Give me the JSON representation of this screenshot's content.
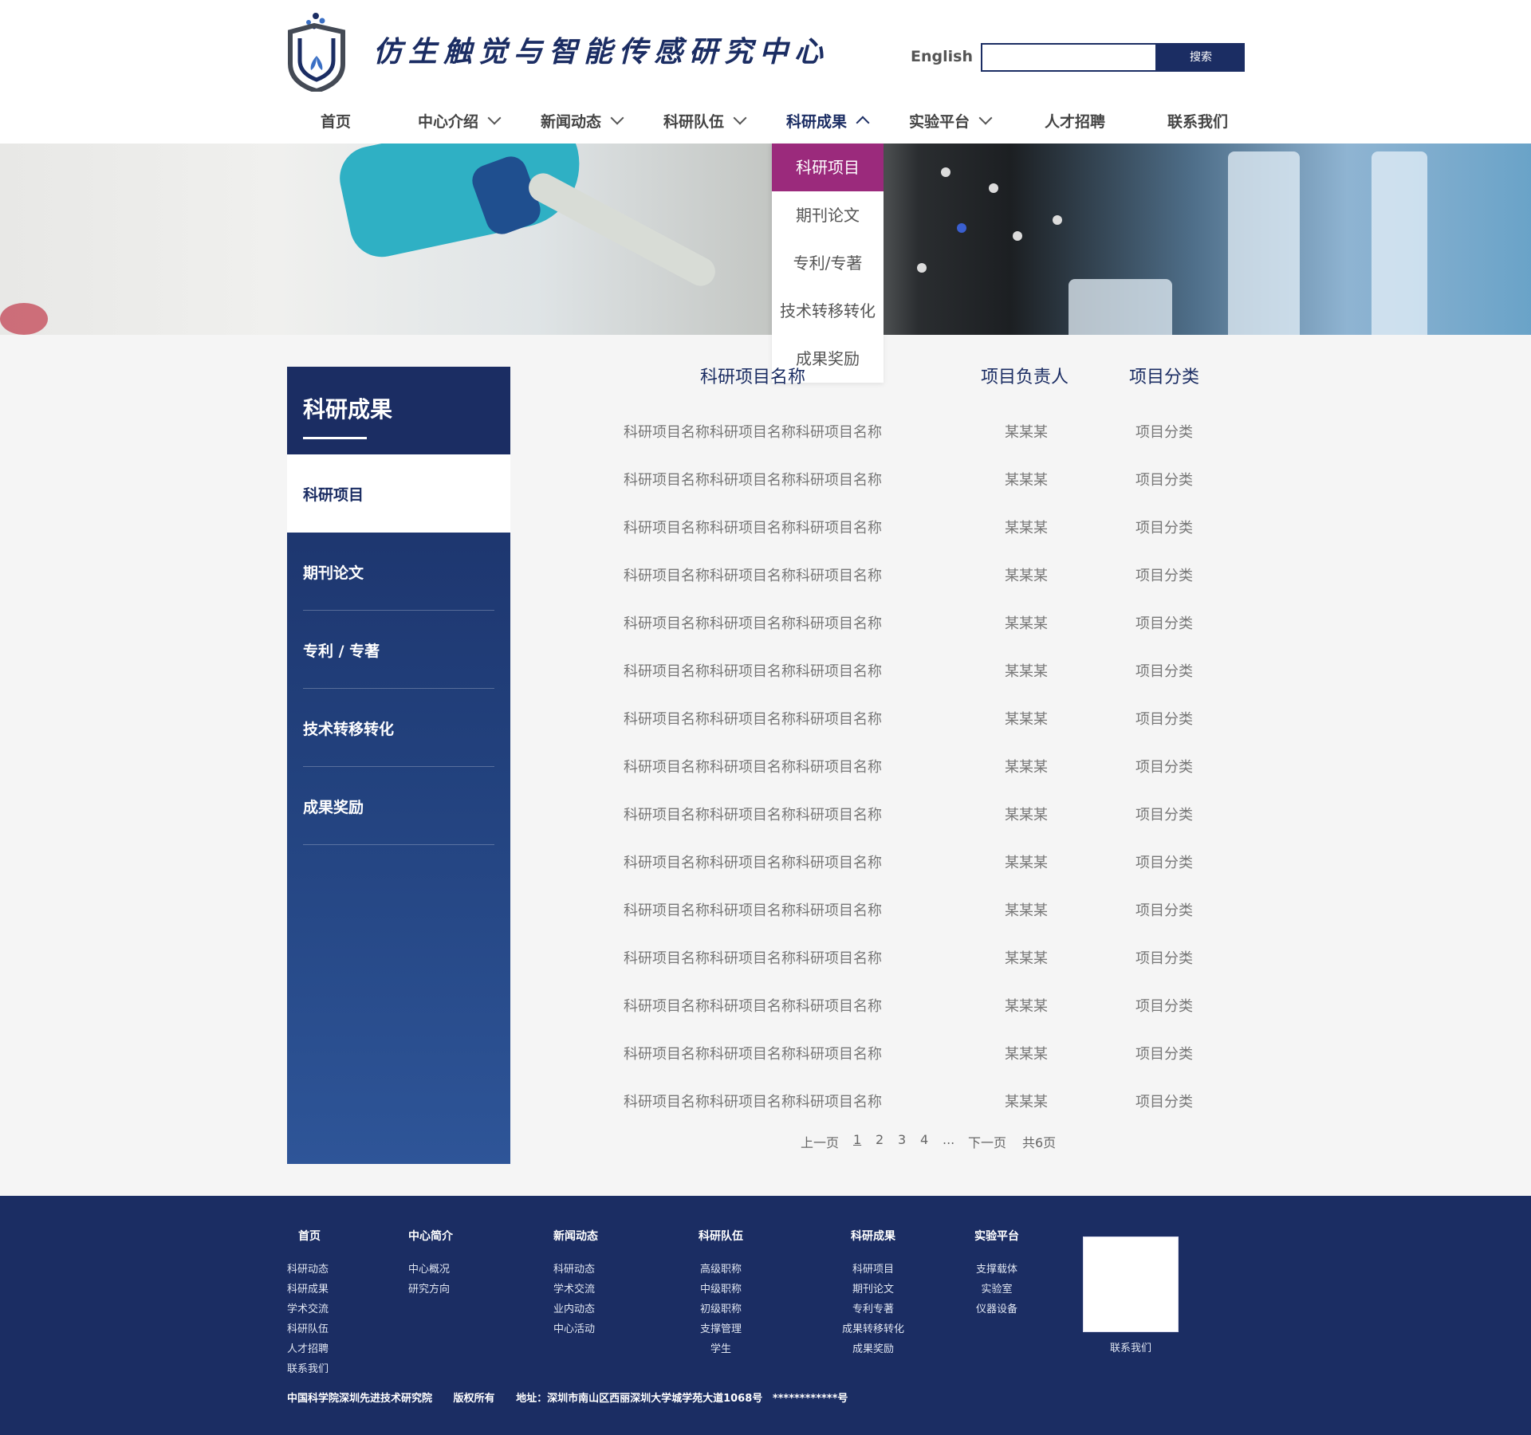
{
  "header": {
    "site_title": "仿生触觉与智能传感研究中心",
    "lang_link": "English",
    "search_placeholder": "",
    "search_button": "搜索"
  },
  "nav": {
    "items": [
      {
        "label": "首页",
        "has_dropdown": false
      },
      {
        "label": "中心介绍",
        "has_dropdown": true
      },
      {
        "label": "新闻动态",
        "has_dropdown": true
      },
      {
        "label": "科研队伍",
        "has_dropdown": true
      },
      {
        "label": "科研成果",
        "has_dropdown": true,
        "active": true
      },
      {
        "label": "实验平台",
        "has_dropdown": true
      },
      {
        "label": "人才招聘",
        "has_dropdown": false
      },
      {
        "label": "联系我们",
        "has_dropdown": false
      }
    ]
  },
  "dropdown": {
    "items": [
      "科研项目",
      "期刊论文",
      "专利/专著",
      "技术转移转化",
      "成果奖励"
    ],
    "active_index": 0
  },
  "sidebar": {
    "title": "科研成果",
    "items": [
      "科研项目",
      "期刊论文",
      "专利 / 专著",
      "技术转移转化",
      "成果奖励"
    ],
    "active_index": 0
  },
  "table": {
    "headers": [
      "科研项目名称",
      "项目负责人",
      "项目分类"
    ],
    "rows": [
      [
        "科研项目名称科研项目名称科研项目名称",
        "某某某",
        "项目分类"
      ],
      [
        "科研项目名称科研项目名称科研项目名称",
        "某某某",
        "项目分类"
      ],
      [
        "科研项目名称科研项目名称科研项目名称",
        "某某某",
        "项目分类"
      ],
      [
        "科研项目名称科研项目名称科研项目名称",
        "某某某",
        "项目分类"
      ],
      [
        "科研项目名称科研项目名称科研项目名称",
        "某某某",
        "项目分类"
      ],
      [
        "科研项目名称科研项目名称科研项目名称",
        "某某某",
        "项目分类"
      ],
      [
        "科研项目名称科研项目名称科研项目名称",
        "某某某",
        "项目分类"
      ],
      [
        "科研项目名称科研项目名称科研项目名称",
        "某某某",
        "项目分类"
      ],
      [
        "科研项目名称科研项目名称科研项目名称",
        "某某某",
        "项目分类"
      ],
      [
        "科研项目名称科研项目名称科研项目名称",
        "某某某",
        "项目分类"
      ],
      [
        "科研项目名称科研项目名称科研项目名称",
        "某某某",
        "项目分类"
      ],
      [
        "科研项目名称科研项目名称科研项目名称",
        "某某某",
        "项目分类"
      ],
      [
        "科研项目名称科研项目名称科研项目名称",
        "某某某",
        "项目分类"
      ],
      [
        "科研项目名称科研项目名称科研项目名称",
        "某某某",
        "项目分类"
      ],
      [
        "科研项目名称科研项目名称科研项目名称",
        "某某某",
        "项目分类"
      ]
    ]
  },
  "pagination": {
    "prev": "上一页",
    "pages": [
      "1",
      "2",
      "3",
      "4"
    ],
    "current": "1",
    "ellipsis": "...",
    "next": "下一页",
    "total": "共6页"
  },
  "footer": {
    "columns": [
      {
        "head": "首页",
        "links": [
          "科研动态",
          "科研成果",
          "学术交流",
          "科研队伍",
          "人才招聘",
          "联系我们"
        ]
      },
      {
        "head": "中心简介",
        "links": [
          "中心概况",
          "研究方向"
        ]
      },
      {
        "head": "新闻动态",
        "links": [
          "科研动态",
          "学术交流",
          "业内动态",
          "中心活动"
        ]
      },
      {
        "head": "科研队伍",
        "links": [
          "高级职称",
          "中级职称",
          "初级职称",
          "支撑管理",
          "学生"
        ]
      },
      {
        "head": "科研成果",
        "links": [
          "科研项目",
          "期刊论文",
          "专利专著",
          "成果转移转化",
          "成果奖励"
        ]
      },
      {
        "head": "实验平台",
        "links": [
          "支撑载体",
          "实验室",
          "仪器设备"
        ]
      }
    ],
    "qr_label": "联系我们",
    "copyright": {
      "org": "中国科学院深圳先进技术研究院",
      "rights": "版权所有",
      "address": "地址：深圳市南山区西丽深圳大学城学苑大道1068号",
      "icp": "************号"
    }
  },
  "colors": {
    "brand_navy": "#1b2d63",
    "accent_magenta": "#9b2a7c"
  }
}
